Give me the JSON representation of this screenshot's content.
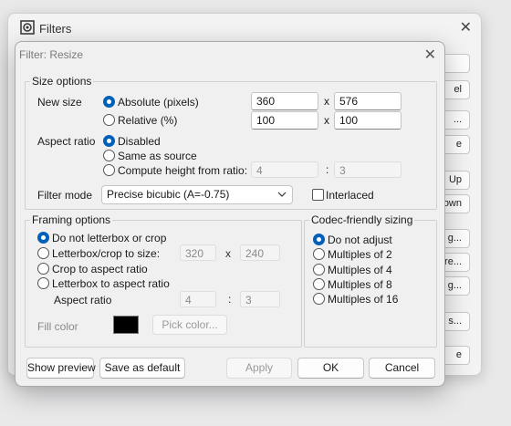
{
  "background_window": {
    "title": "Filters",
    "buttons": [
      "",
      "el",
      "...",
      "e",
      "Up",
      "own",
      "g...",
      "re...",
      "g...",
      "s...",
      "e"
    ]
  },
  "dialog": {
    "title": "Filter: Resize",
    "size_options": {
      "legend": "Size options",
      "new_size_label": "New size",
      "absolute_label": "Absolute (pixels)",
      "absolute_width": "360",
      "absolute_height": "576",
      "relative_label": "Relative (%)",
      "relative_width": "100",
      "relative_height": "100",
      "times_sign": "x",
      "aspect_ratio_label": "Aspect ratio",
      "disabled_label": "Disabled",
      "same_as_source_label": "Same as source",
      "compute_height_label": "Compute height from ratio:",
      "ratio_a": "4",
      "ratio_b": "3",
      "colon": ":",
      "filter_mode_label": "Filter mode",
      "filter_mode_value": "Precise bicubic (A=-0.75)",
      "interlaced_label": "Interlaced"
    },
    "framing_options": {
      "legend": "Framing options",
      "do_not_letterbox_label": "Do not letterbox or crop",
      "letterbox_crop_label": "Letterbox/crop to size:",
      "letterbox_width": "320",
      "letterbox_height": "240",
      "times_sign": "x",
      "crop_aspect_label": "Crop to aspect ratio",
      "letterbox_aspect_label": "Letterbox to aspect ratio",
      "aspect_ratio_label": "Aspect ratio",
      "ratio_a": "4",
      "ratio_b": "3",
      "colon": ":",
      "fill_color_label": "Fill color",
      "fill_color": "#000000",
      "pick_color_label": "Pick color..."
    },
    "codec_sizing": {
      "legend": "Codec-friendly sizing",
      "options": [
        "Do not adjust",
        "Multiples of 2",
        "Multiples of 4",
        "Multiples of 8",
        "Multiples of 16"
      ]
    },
    "buttons": {
      "show_preview": "Show preview",
      "save_default": "Save as default",
      "apply": "Apply",
      "ok": "OK",
      "cancel": "Cancel"
    }
  },
  "colors": {
    "accent": "#005fb8"
  }
}
